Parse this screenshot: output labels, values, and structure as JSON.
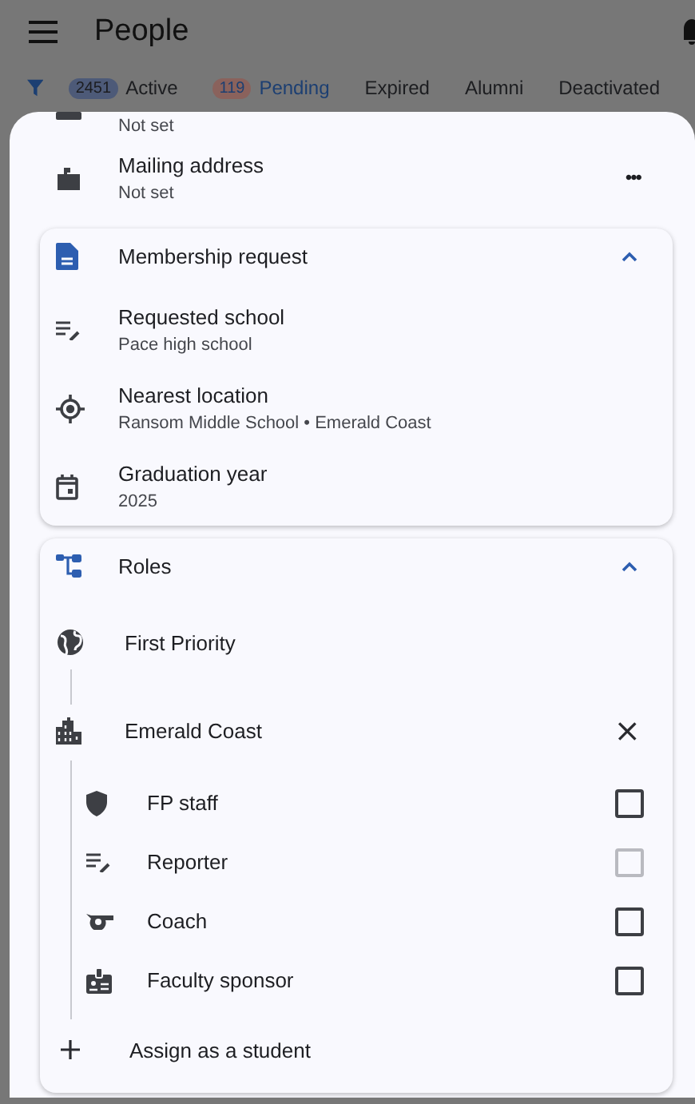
{
  "app_bar": {
    "title": "People"
  },
  "filter_tabs": [
    {
      "label": "Active",
      "count": "2451",
      "color": "#4d5a78",
      "selected": false
    },
    {
      "label": "Pending",
      "count": "119",
      "color": "#8a625c",
      "selected": true
    },
    {
      "label": "Expired",
      "selected": false
    },
    {
      "label": "Alumni",
      "selected": false
    },
    {
      "label": "Deactivated",
      "selected": false
    }
  ],
  "details": [
    {
      "value": "Not set"
    },
    {
      "label": "Mailing address",
      "value": "Not set",
      "more": "•••"
    }
  ],
  "membership_request": {
    "title": "Membership request",
    "expanded": true,
    "items": [
      {
        "label": "Requested school",
        "value": "Pace high school"
      },
      {
        "label": "Nearest location",
        "value": "Ransom Middle School • Emerald Coast"
      },
      {
        "label": "Graduation year",
        "value": "2025"
      }
    ]
  },
  "roles": {
    "title": "Roles",
    "expanded": true,
    "tree": [
      {
        "label": "First Priority",
        "children": [
          {
            "label": "Emerald Coast",
            "remove": "×",
            "children": [
              {
                "label": "FP staff",
                "checked": false,
                "disabled": false
              },
              {
                "label": "Reporter",
                "checked": false,
                "disabled": true
              },
              {
                "label": "Coach",
                "checked": false,
                "disabled": false
              },
              {
                "label": "Faculty sponsor",
                "checked": false,
                "disabled": false
              }
            ]
          }
        ]
      }
    ],
    "add_action": "Assign as a student"
  }
}
